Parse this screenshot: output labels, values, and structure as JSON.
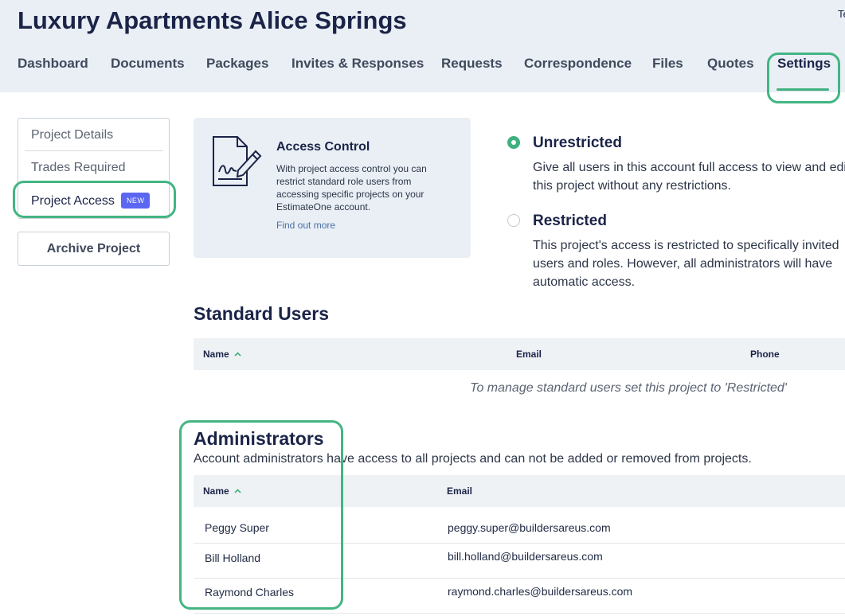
{
  "header": {
    "title": "Luxury Apartments Alice Springs",
    "corner_text": "Te"
  },
  "nav": {
    "tabs": [
      {
        "label": "Dashboard"
      },
      {
        "label": "Documents"
      },
      {
        "label": "Packages"
      },
      {
        "label": "Invites & Responses"
      },
      {
        "label": "Requests"
      },
      {
        "label": "Correspondence"
      },
      {
        "label": "Files"
      },
      {
        "label": "Quotes"
      },
      {
        "label": "Settings",
        "active": true
      }
    ]
  },
  "sidebar": {
    "items": [
      {
        "label": "Project Details"
      },
      {
        "label": "Trades Required"
      },
      {
        "label": "Project Access",
        "badge": "NEW",
        "active": true
      }
    ],
    "archive_label": "Archive Project"
  },
  "access_card": {
    "icon": "document-signature-icon",
    "title": "Access Control",
    "body": "With project access control you can restrict standard role users from accessing specific projects on your EstimateOne account.",
    "link": "Find out more"
  },
  "access_options": [
    {
      "title": "Unrestricted",
      "description": "Give all users in this account full access to view and edit this project without any restrictions.",
      "checked": true
    },
    {
      "title": "Restricted",
      "description": "This project's access is restricted to specifically invited users and roles. However, all administrators will have automatic access.",
      "checked": false
    }
  ],
  "standard_users": {
    "title": "Standard Users",
    "columns": [
      "Name",
      "Email",
      "Phone"
    ],
    "empty_text": "To manage standard users set this project to 'Restricted'"
  },
  "administrators": {
    "title": "Administrators",
    "subtitle": "Account administrators have access to all projects and can not be added or removed from projects.",
    "columns": [
      "Name",
      "Email"
    ],
    "rows": [
      {
        "name": "Peggy Super",
        "email": "peggy.super@buildersareus.com"
      },
      {
        "name": "Bill Holland",
        "email": "bill.holland@buildersareus.com"
      },
      {
        "name": "Raymond Charles",
        "email": "raymond.charles@buildersareus.com"
      }
    ]
  },
  "colors": {
    "accent_green": "#3fb07f",
    "badge_blue": "#5b67f1",
    "header_bg": "#e9eff5",
    "title_navy": "#1b2448"
  }
}
